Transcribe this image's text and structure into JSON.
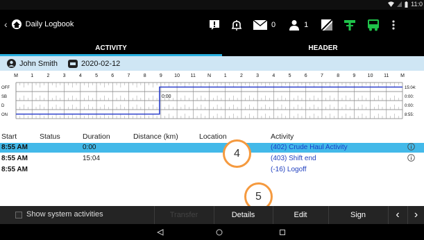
{
  "status_bar": {
    "time": "11:0"
  },
  "app_bar": {
    "title": "Daily Logbook",
    "mail_count": "0",
    "user_count": "1"
  },
  "tabs": {
    "activity": "ACTIVITY",
    "header": "HEADER"
  },
  "driver": {
    "name": "John Smith",
    "date": "2020-02-12"
  },
  "grid": {
    "hour_labels": [
      "M",
      "1",
      "2",
      "3",
      "4",
      "5",
      "6",
      "7",
      "8",
      "9",
      "10",
      "11",
      "N",
      "1",
      "2",
      "3",
      "4",
      "5",
      "6",
      "7",
      "8",
      "9",
      "10",
      "11",
      "M"
    ],
    "row_labels": [
      "OFF",
      "SB",
      "D",
      "ON"
    ],
    "totals": [
      "15:04:",
      "0:00:",
      "0:00:",
      "8:55:"
    ],
    "cursor_label": "0:00",
    "line_color": "#2b3fc9"
  },
  "table": {
    "headers": {
      "start": "Start",
      "status": "Status",
      "duration": "Duration",
      "distance": "Distance (km)",
      "location": "Location",
      "activity": "Activity"
    },
    "rows": [
      {
        "start": "8:55 AM",
        "duration": "0:00",
        "activity": "(402) Crude Haul Activity",
        "info": true,
        "selected": true
      },
      {
        "start": "8:55 AM",
        "duration": "15:04",
        "activity": "(403) Shift end",
        "info": true,
        "selected": false
      },
      {
        "start": "8:55 AM",
        "duration": "",
        "activity": "(-16) Logoff",
        "info": false,
        "selected": false
      }
    ]
  },
  "badges": {
    "four": "4",
    "five": "5"
  },
  "bottom": {
    "show_system": "Show system activities",
    "transfer": "Transfer",
    "details": "Details",
    "edit": "Edit",
    "sign": "Sign",
    "prev": "‹",
    "next": "›"
  },
  "colors": {
    "accent": "#29b0e0",
    "highlight": "#43b9e9",
    "badge_ring": "#f59a3f",
    "link": "#1f3fbf",
    "driver_bar": "#cfe6f4"
  }
}
